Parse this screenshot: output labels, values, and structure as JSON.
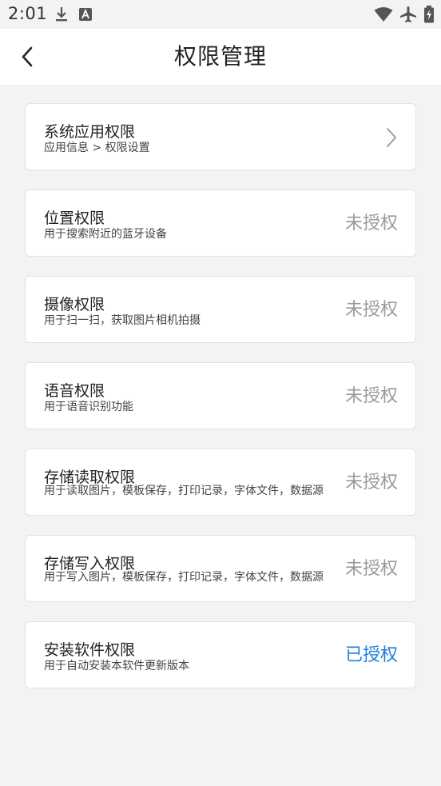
{
  "status_bar": {
    "time": "2:01"
  },
  "header": {
    "title": "权限管理"
  },
  "permissions": [
    {
      "title": "系统应用权限",
      "desc": "应用信息 > 权限设置",
      "status": "",
      "has_chevron": true
    },
    {
      "title": "位置权限",
      "desc": "用于搜索附近的蓝牙设备",
      "status": "未授权"
    },
    {
      "title": "摄像权限",
      "desc": "用于扫一扫，获取图片相机拍摄",
      "status": "未授权"
    },
    {
      "title": "语音权限",
      "desc": "用于语音识别功能",
      "status": "未授权"
    },
    {
      "title": "存储读取权限",
      "desc": "用于读取图片，模板保存，打印记录，字体文件，数据源",
      "status": "未授权"
    },
    {
      "title": "存储写入权限",
      "desc": "用于写入图片，模板保存，打印记录，字体文件，数据源",
      "status": "未授权"
    },
    {
      "title": "安装软件权限",
      "desc": "用于自动安装本软件更新版本",
      "status": "已授权"
    }
  ],
  "colors": {
    "granted": "#1f7fd9",
    "not_granted": "#9a9a9a"
  },
  "icons": {
    "status_left": [
      "download-icon",
      "a-box-icon"
    ],
    "status_right": [
      "wifi-icon",
      "airplane-icon",
      "battery-charging-icon"
    ],
    "back": "back-arrow-icon",
    "chevron": "chevron-right-icon"
  }
}
